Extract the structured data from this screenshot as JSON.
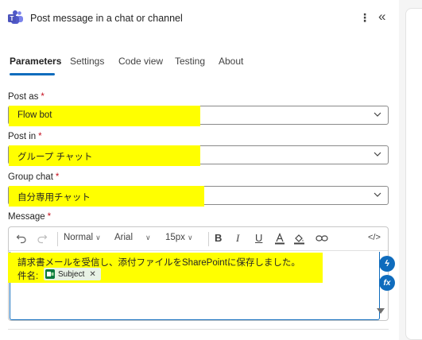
{
  "header": {
    "title": "Post message in a chat or channel",
    "more_icon": "more-vertical-icon",
    "collapse_icon": "double-chevron-left-icon"
  },
  "tabs": [
    {
      "label": "Parameters",
      "active": true
    },
    {
      "label": "Settings",
      "active": false
    },
    {
      "label": "Code view",
      "active": false
    },
    {
      "label": "Testing",
      "active": false
    },
    {
      "label": "About",
      "active": false
    }
  ],
  "fields": {
    "post_as": {
      "label": "Post as",
      "required": "*",
      "value": "Flow bot"
    },
    "post_in": {
      "label": "Post in",
      "required": "*",
      "value": "グループ チャット"
    },
    "group_chat": {
      "label": "Group chat",
      "required": "*",
      "value": "自分専用チャット"
    },
    "message": {
      "label": "Message",
      "required": "*"
    }
  },
  "toolbar": {
    "undo_icon": "undo-icon",
    "redo_icon": "redo-icon",
    "paragraph_style": "Normal",
    "font": "Arial",
    "font_size": "15px",
    "bold": "B",
    "italic": "I",
    "underline": "U",
    "code_view": "</>"
  },
  "message_body": {
    "line1": "請求書メールを受信し、添付ファイルをSharePointに保存しました。",
    "line2_label": "件名:",
    "token": {
      "label": "Subject",
      "icon": "outlook-icon"
    }
  },
  "side_buttons": {
    "dynamic_content": "ϟ",
    "expression": "fx"
  },
  "colors": {
    "accent": "#0f6cbd",
    "highlight": "#ffff00",
    "required": "#c50f1f",
    "token_bg": "#e8f2e5"
  }
}
